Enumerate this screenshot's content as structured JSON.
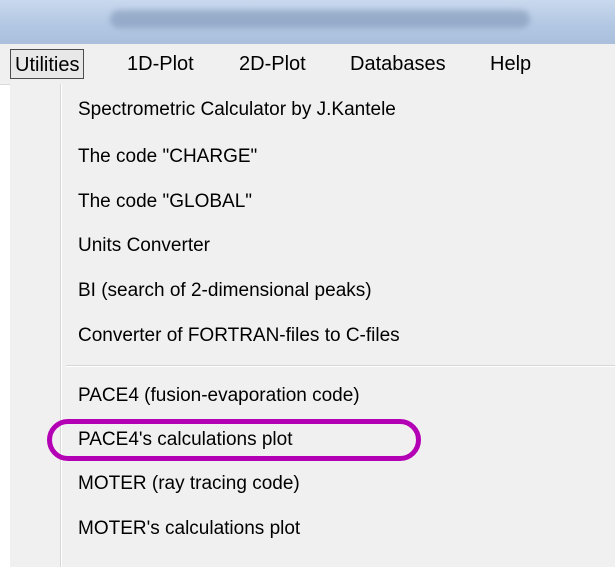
{
  "window": {
    "title": ""
  },
  "menubar": {
    "items": [
      {
        "label": "Utilities",
        "active": true
      },
      {
        "label": "1D-Plot",
        "active": false
      },
      {
        "label": "2D-Plot",
        "active": false
      },
      {
        "label": "Databases",
        "active": false
      },
      {
        "label": "Help",
        "active": false
      }
    ]
  },
  "dropdown": {
    "group1": [
      "Spectrometric Calculator by J.Kantele",
      "The code \"CHARGE\"",
      "The code \"GLOBAL\"",
      "Units Converter",
      "BI (search of 2-dimensional peaks)",
      "Converter of FORTRAN-files to C-files"
    ],
    "group2": [
      "PACE4 (fusion-evaporation code)",
      "PACE4's calculations plot",
      "MOTER (ray tracing code)",
      "MOTER's calculations plot"
    ],
    "highlighted_item": "PACE4's calculations plot",
    "highlight_color": "#b400b4"
  }
}
